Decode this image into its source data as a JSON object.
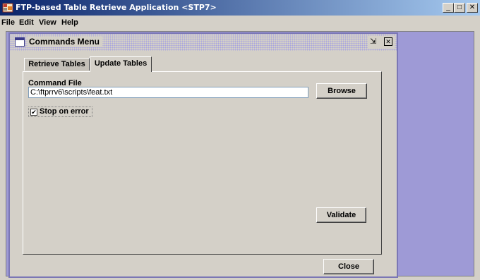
{
  "window": {
    "title": "FTP-based Table Retrieve Application <STP7>",
    "minimize_icon": "minimize-icon",
    "maximize_icon": "maximize-icon",
    "close_icon": "close-icon",
    "minimize_glyph": "_",
    "maximize_glyph": "□",
    "close_glyph": "✕"
  },
  "menubar": {
    "items": [
      "File",
      "Edit",
      "View",
      "Help"
    ]
  },
  "internal_frame": {
    "title": "Commands Menu",
    "restore_glyph": "⇲",
    "close_glyph": "✕"
  },
  "tabs": {
    "items": [
      {
        "label": "Retrieve Tables",
        "selected": false
      },
      {
        "label": "Update Tables",
        "selected": true
      }
    ]
  },
  "command_file": {
    "label": "Command File",
    "value": "C:\\ftprrv6\\scripts\\feat.txt",
    "browse_label": "Browse"
  },
  "stop_on_error": {
    "label": "Stop on error",
    "checked": true,
    "check_glyph": "✔"
  },
  "validate_label": "Validate",
  "close_label": "Close",
  "colors": {
    "desktop": "#9e9ad6",
    "title_start": "#0a246a",
    "title_end": "#a6caf0",
    "panel": "#d4d0c8"
  }
}
